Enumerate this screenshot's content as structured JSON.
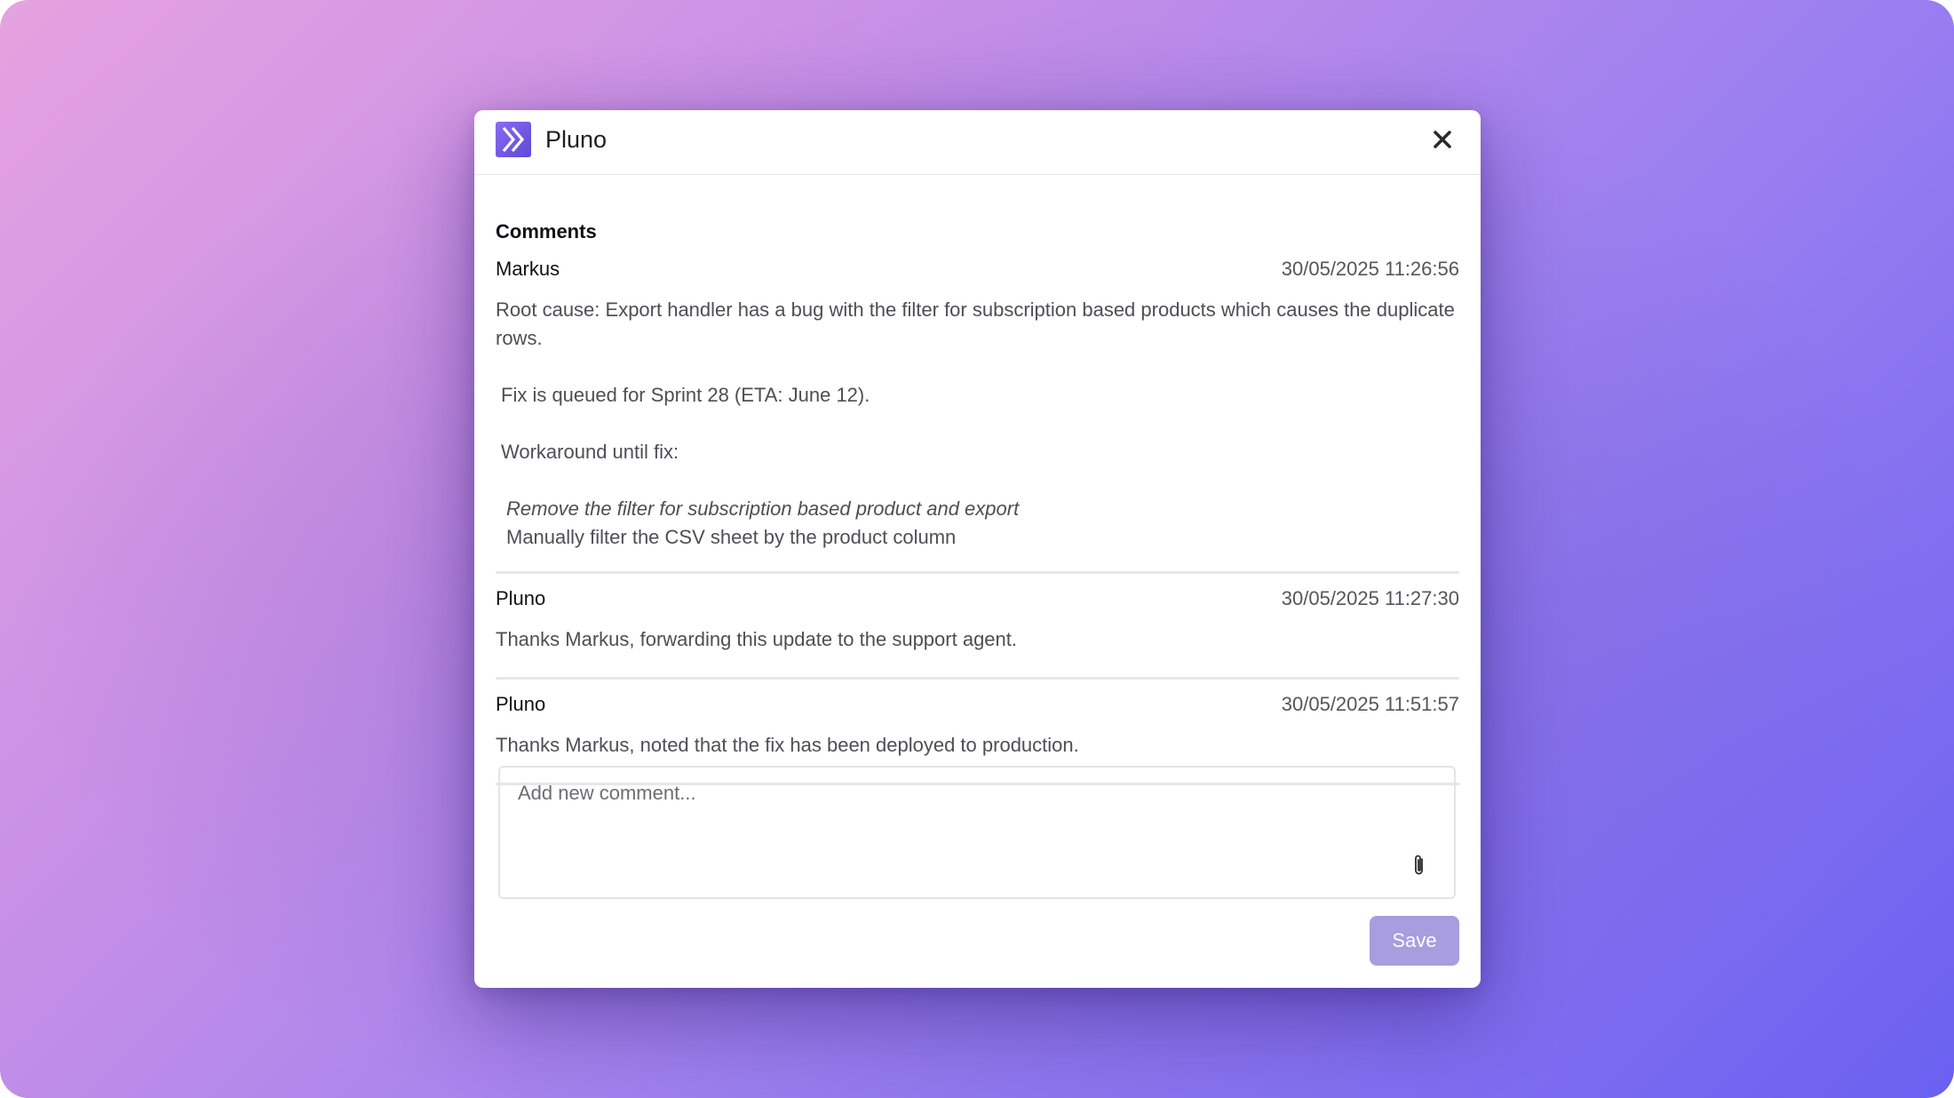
{
  "app": {
    "title": "Pluno",
    "logo_icon": "double-chevron-right-icon",
    "close_icon": "close-icon"
  },
  "section": {
    "title": "Comments"
  },
  "comments": [
    {
      "author": "Markus",
      "timestamp": "30/05/2025 11:26:56",
      "lines": [
        "Root cause: Export handler has a bug with the filter for subscription based products which causes the duplicate rows.",
        "Fix is queued for Sprint 28 (ETA: June 12).",
        "Workaround until fix:",
        "Remove the filter for subscription based product and export",
        "Manually filter the CSV sheet by the product column"
      ]
    },
    {
      "author": "Pluno",
      "timestamp": "30/05/2025 11:27:30",
      "lines": [
        "Thanks Markus, forwarding this update to the support agent."
      ]
    },
    {
      "author": "Pluno",
      "timestamp": "30/05/2025 11:51:57",
      "lines": [
        "Thanks Markus, noted that the fix has been deployed to production."
      ]
    }
  ],
  "composer": {
    "placeholder": "Add new comment...",
    "value": "",
    "attach_icon": "paperclip-icon",
    "save_label": "Save"
  },
  "colors": {
    "accent": "#6a55e0",
    "save_button": "#a79ddf",
    "background_start": "#e5a2e0",
    "background_end": "#6a60f0"
  }
}
